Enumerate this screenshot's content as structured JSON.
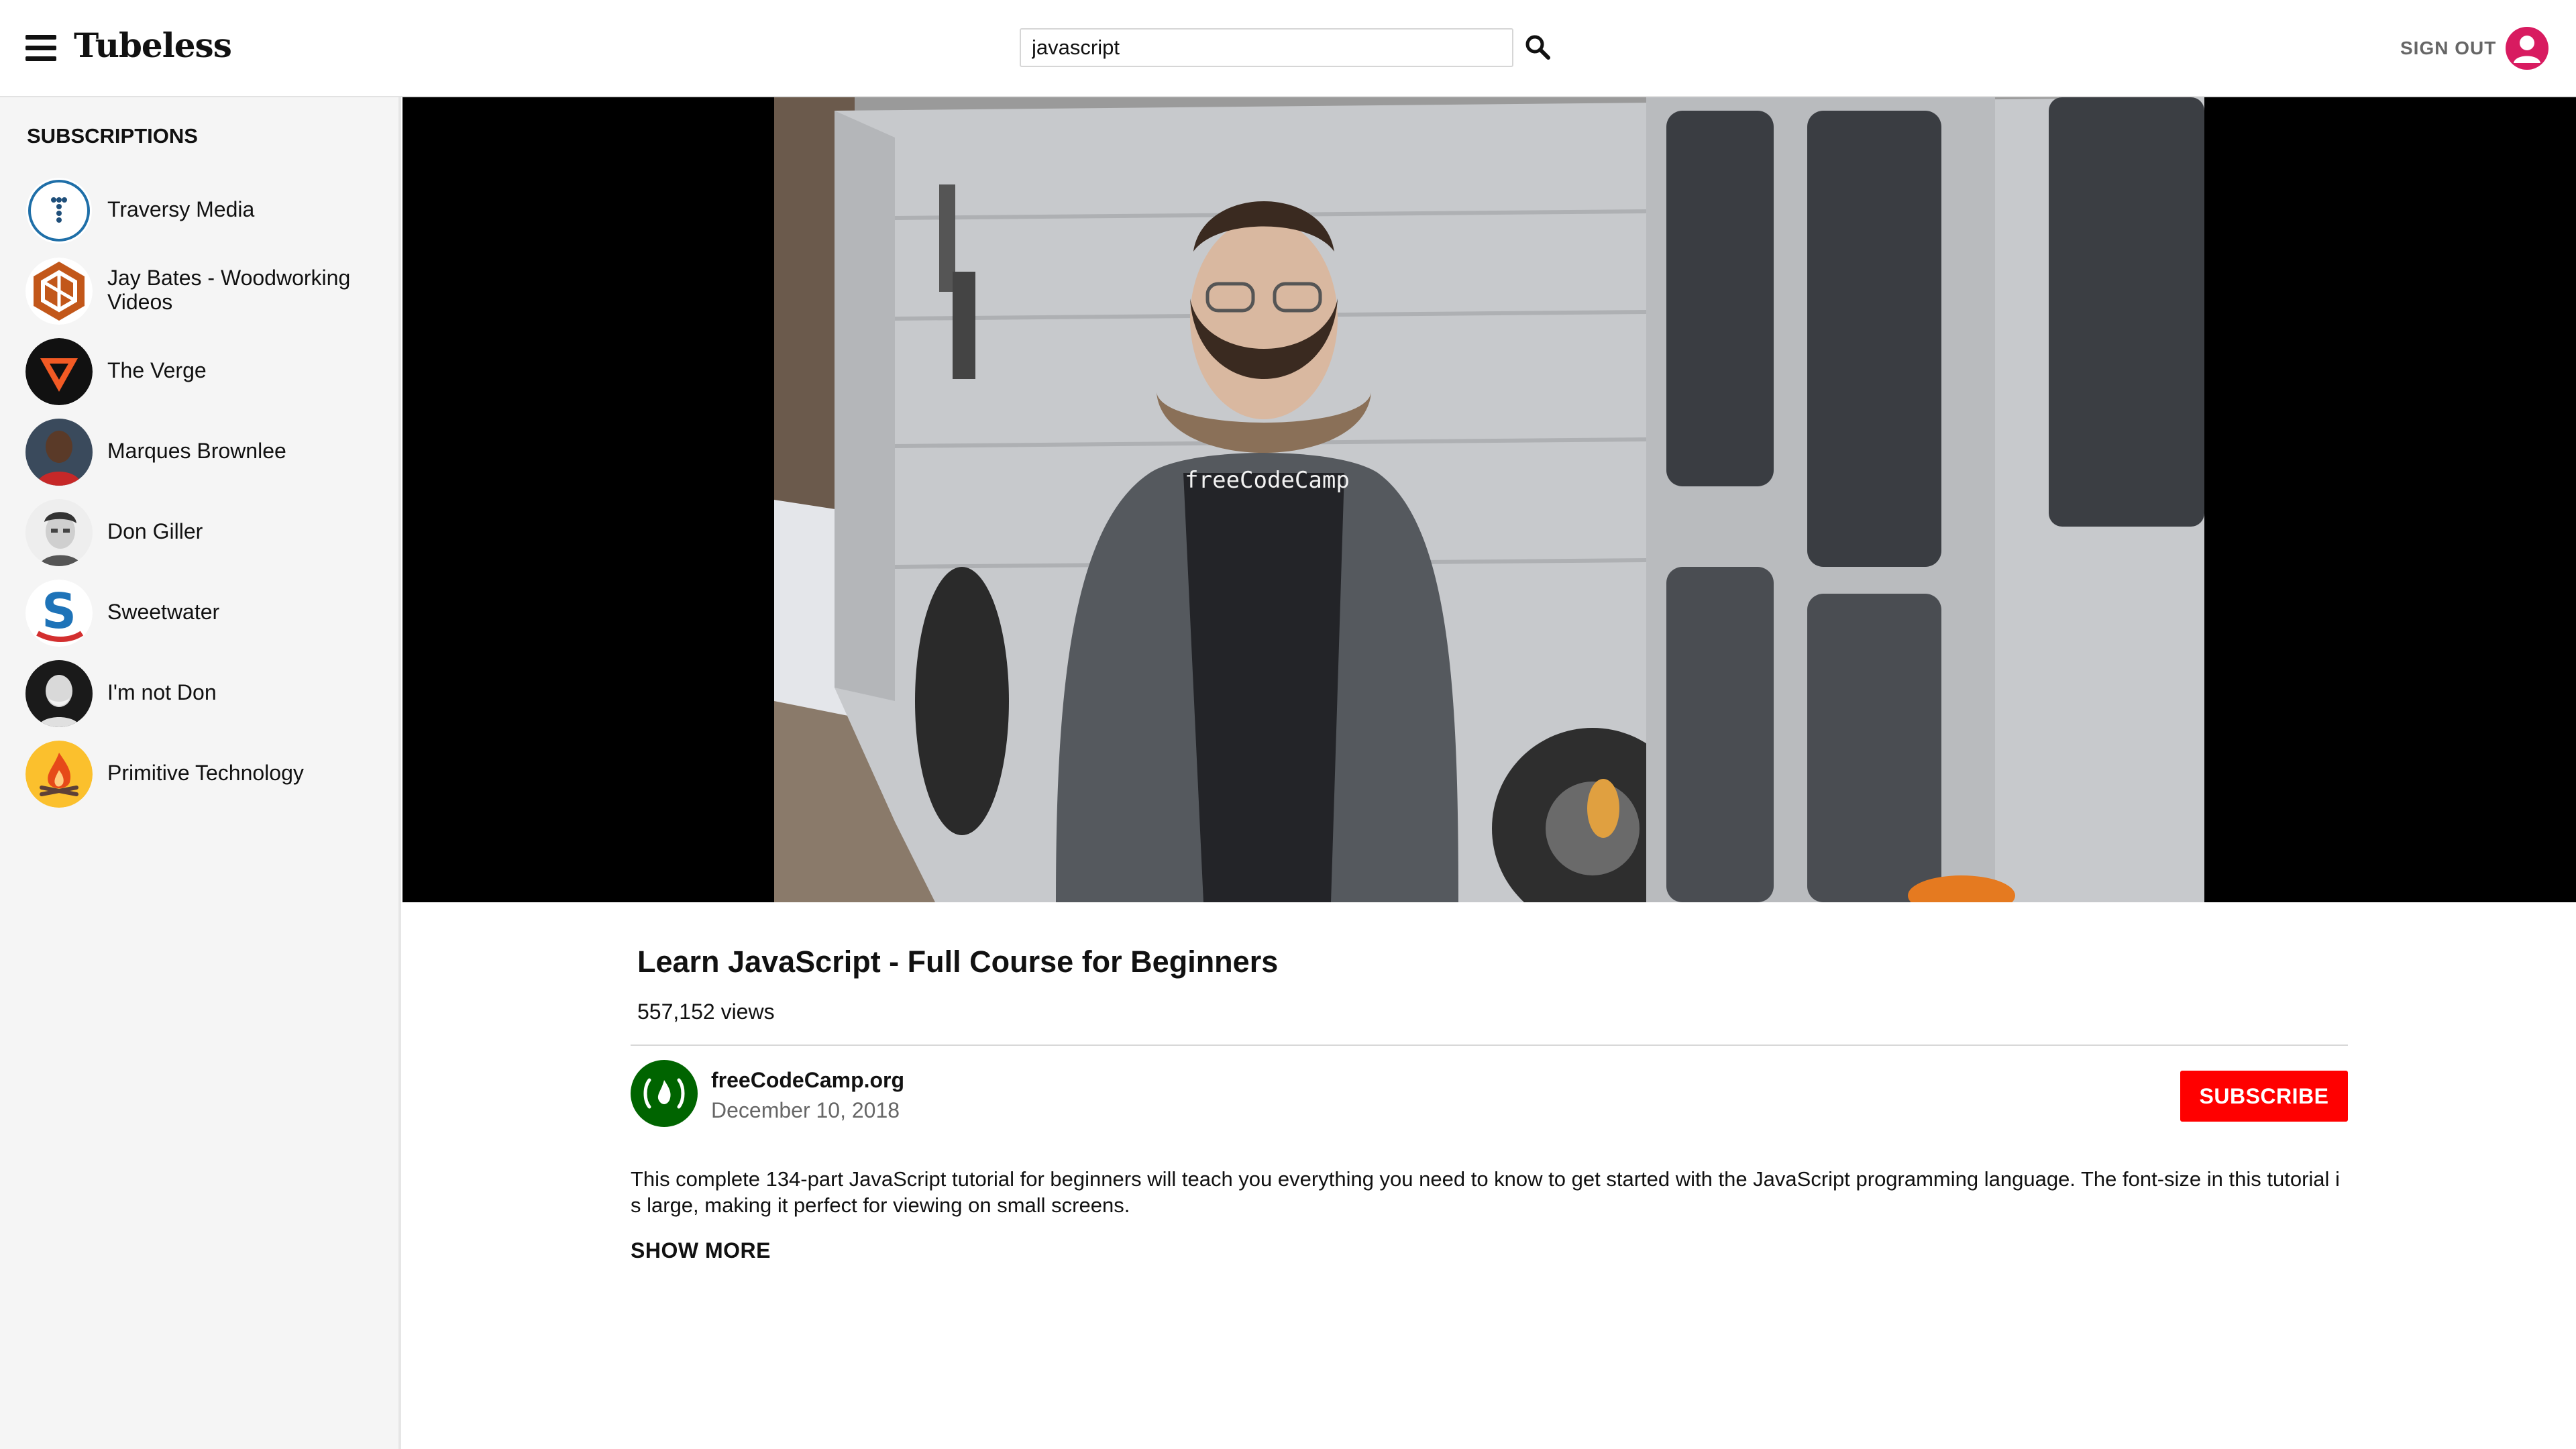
{
  "header": {
    "logo": "Tubeless",
    "search_value": "javascript",
    "sign_out_label": "SIGN OUT"
  },
  "sidebar": {
    "title": "SUBSCRIPTIONS",
    "items": [
      {
        "label": "Traversy Media",
        "icon": "traversy-logo"
      },
      {
        "label": "Jay Bates - Woodworking Videos",
        "icon": "jay-bates-logo"
      },
      {
        "label": "The Verge",
        "icon": "verge-logo"
      },
      {
        "label": "Marques Brownlee",
        "icon": "person-photo"
      },
      {
        "label": "Don Giller",
        "icon": "person-photo"
      },
      {
        "label": "Sweetwater",
        "icon": "sweetwater-logo"
      },
      {
        "label": "I'm not Don",
        "icon": "person-photo"
      },
      {
        "label": "Primitive Technology",
        "icon": "campfire-logo"
      }
    ]
  },
  "video": {
    "frame_shirt_text": "freeCodeCamp",
    "title": "Learn JavaScript - Full Course for Beginners",
    "views": "557,152 views",
    "channel": "freeCodeCamp.org",
    "date": "December 10, 2018",
    "subscribe_label": "SUBSCRIBE",
    "description": "This complete 134-part JavaScript tutorial for beginners will teach you everything you need to know to get started with the JavaScript programming language. The font-size in this tutorial is large, making it perfect for viewing on small screens.",
    "show_more_label": "SHOW MORE"
  },
  "colors": {
    "subscribe": "#ff0000",
    "channel_logo": "#006400",
    "user_avatar": "#d81b60",
    "sidebar_bg": "#f5f5f5"
  }
}
